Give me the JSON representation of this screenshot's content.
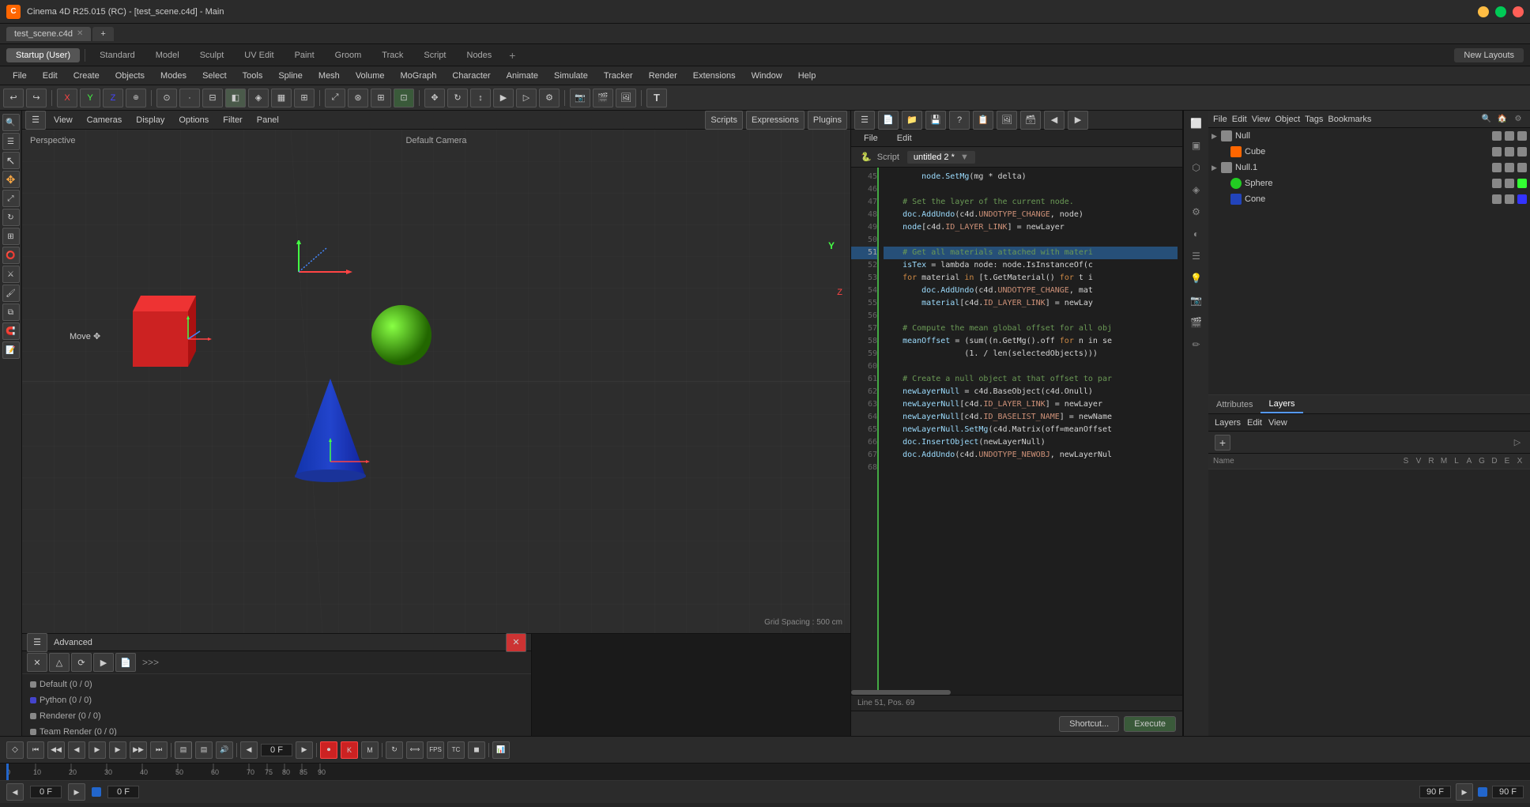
{
  "titleBar": {
    "appName": "Cinema 4D R25.015 (RC)",
    "fileName": "test_scene.c4d",
    "windowTitle": "Cinema 4D R25.015 (RC) - [test_scene.c4d] - Main",
    "controls": [
      "minimize",
      "maximize",
      "close"
    ]
  },
  "fileTabs": [
    {
      "name": "test_scene.c4d",
      "active": true,
      "closable": true
    }
  ],
  "layoutTabs": [
    {
      "id": "startup",
      "label": "Startup (User)",
      "active": true
    },
    {
      "id": "standard",
      "label": "Standard",
      "active": false
    },
    {
      "id": "model",
      "label": "Model",
      "active": false
    },
    {
      "id": "sculpt",
      "label": "Sculpt",
      "active": false
    },
    {
      "id": "uvEdit",
      "label": "UV Edit",
      "active": false
    },
    {
      "id": "paint",
      "label": "Paint",
      "active": false
    },
    {
      "id": "groom",
      "label": "Groom",
      "active": false
    },
    {
      "id": "track",
      "label": "Track",
      "active": false
    },
    {
      "id": "script",
      "label": "Script",
      "active": false
    },
    {
      "id": "nodes",
      "label": "Nodes",
      "active": false
    }
  ],
  "newLayoutsBtn": "New Layouts",
  "menuItems": [
    "File",
    "Edit",
    "Create",
    "Objects",
    "Modes",
    "Select",
    "Tools",
    "Spline",
    "Mesh",
    "Volume",
    "MoGraph",
    "Character",
    "Animate",
    "Simulate",
    "Tracker",
    "Render",
    "Extensions",
    "Window",
    "Help"
  ],
  "viewport": {
    "mode": "Perspective",
    "camera": "Default Camera",
    "gridSpacing": "Grid Spacing : 500 cm",
    "tools": [
      "View",
      "Cameras",
      "Display",
      "Options",
      "Filter",
      "Panel"
    ],
    "toolbar": [
      "Scripts",
      "Expressions",
      "Plugins"
    ]
  },
  "scriptEditor": {
    "title": "Script",
    "fileTab": "File",
    "editTab": "Edit",
    "tabs": [
      {
        "icon": "python",
        "label": "Script"
      },
      {
        "label": "untitled 2 *",
        "active": true
      }
    ],
    "codeLines": [
      {
        "num": "45",
        "text": "        node.SetMg(mg * delta)",
        "highlighted": false
      },
      {
        "num": "46",
        "text": "",
        "highlighted": false
      },
      {
        "num": "47",
        "text": "    # Set the layer of the current node.",
        "highlighted": false,
        "comment": true
      },
      {
        "num": "48",
        "text": "    doc.AddUndo(c4d.UNDOTYPE_CHANGE, node)",
        "highlighted": false
      },
      {
        "num": "49",
        "text": "    node[c4d.ID_LAYER_LINK] = newLayer",
        "highlighted": false
      },
      {
        "num": "50",
        "text": "",
        "highlighted": false
      },
      {
        "num": "51",
        "text": "    # Get all materials attached with materi",
        "highlighted": true
      },
      {
        "num": "52",
        "text": "    isTex = lambda node: node.IsInstanceOf(c",
        "highlighted": false
      },
      {
        "num": "53",
        "text": "    for material in [t.GetMaterial() for t i",
        "highlighted": false
      },
      {
        "num": "54",
        "text": "        doc.AddUndo(c4d.UNDOTYPE_CHANGE, mat",
        "highlighted": false
      },
      {
        "num": "55",
        "text": "        material[c4d.ID_LAYER_LINK] = newLay",
        "highlighted": false
      },
      {
        "num": "56",
        "text": "",
        "highlighted": false
      },
      {
        "num": "57",
        "text": "    # Compute the mean global offset for all obj",
        "highlighted": false,
        "comment": true
      },
      {
        "num": "58",
        "text": "    meanOffset = (sum((n.GetMg().off for n in se",
        "highlighted": false
      },
      {
        "num": "59",
        "text": "                 (1. / len(selectedObjects)))",
        "highlighted": false
      },
      {
        "num": "60",
        "text": "",
        "highlighted": false
      },
      {
        "num": "61",
        "text": "    # Create a null object at that offset to par",
        "highlighted": false,
        "comment": true
      },
      {
        "num": "62",
        "text": "    newLayerNull = c4d.BaseObject(c4d.Onull)",
        "highlighted": false
      },
      {
        "num": "63",
        "text": "    newLayerNull[c4d.ID_LAYER_LINK] = newLayer",
        "highlighted": false
      },
      {
        "num": "64",
        "text": "    newLayerNull[c4d.ID_BASELIST_NAME] = newName",
        "highlighted": false
      },
      {
        "num": "65",
        "text": "    newLayerNull.SetMg(c4d.Matrix(off=meanOffset",
        "highlighted": false
      },
      {
        "num": "66",
        "text": "    doc.InsertObject(newLayerNull)",
        "highlighted": false
      },
      {
        "num": "67",
        "text": "    doc.AddUndo(c4d.UNDOTYPE_NEWOBJ, newLayerNul",
        "highlighted": false
      },
      {
        "num": "68",
        "text": "",
        "highlighted": false
      }
    ],
    "statusBar": "Line 51, Pos. 69",
    "shortcutBtn": "Shortcut...",
    "executeBtn": "Execute"
  },
  "objectManager": {
    "menuItems": [
      "File",
      "Edit",
      "View",
      "Object",
      "Tags",
      "Bookmarks"
    ],
    "objects": [
      {
        "name": "Null",
        "indent": 0,
        "icon": "null",
        "iconColor": "#888888"
      },
      {
        "name": "Cube",
        "indent": 1,
        "icon": "cube",
        "iconColor": "#ff6600"
      },
      {
        "name": "Null.1",
        "indent": 0,
        "icon": "null",
        "iconColor": "#888888"
      },
      {
        "name": "Sphere",
        "indent": 1,
        "icon": "sphere",
        "iconColor": "#22cc22"
      },
      {
        "name": "Cone",
        "indent": 1,
        "icon": "cone",
        "iconColor": "#2244bb"
      }
    ]
  },
  "layersPanel": {
    "tabs": [
      {
        "label": "Attributes",
        "active": false
      },
      {
        "label": "Layers",
        "active": true
      }
    ],
    "menuItems": [
      "Layers",
      "Edit",
      "View"
    ],
    "header": {
      "nameCol": "Name",
      "cols": [
        "S",
        "V",
        "R",
        "M",
        "L",
        "A",
        "G",
        "D",
        "E",
        "X"
      ]
    }
  },
  "advancedPanel": {
    "title": "Advanced",
    "items": [
      {
        "label": "Default (0 / 0)",
        "color": "#888888"
      },
      {
        "label": "Python (0 / 0)",
        "color": "#4444cc"
      },
      {
        "label": "Renderer (0 / 0)",
        "color": "#888888"
      },
      {
        "label": "Team Render (0 / 0)",
        "color": "#888888"
      }
    ]
  },
  "timeline": {
    "currentFrame": "0 F",
    "endFrame": "90 F",
    "startFrame": "0 F",
    "currentTime": "0 F",
    "endTime": "90 F",
    "markers": [
      0,
      10,
      20,
      30,
      40,
      50,
      60,
      70,
      75,
      80,
      85,
      90
    ]
  },
  "icons": {
    "move": "✥",
    "rotate": "↻",
    "scale": "⤢",
    "select": "↖",
    "undo": "↩",
    "redo": "↪",
    "play": "▶",
    "pause": "⏸",
    "stop": "■",
    "skipForward": "⏭",
    "skipBack": "⏮",
    "stepForward": "▷",
    "stepBack": "◁",
    "record": "⏺",
    "python": "🐍"
  }
}
